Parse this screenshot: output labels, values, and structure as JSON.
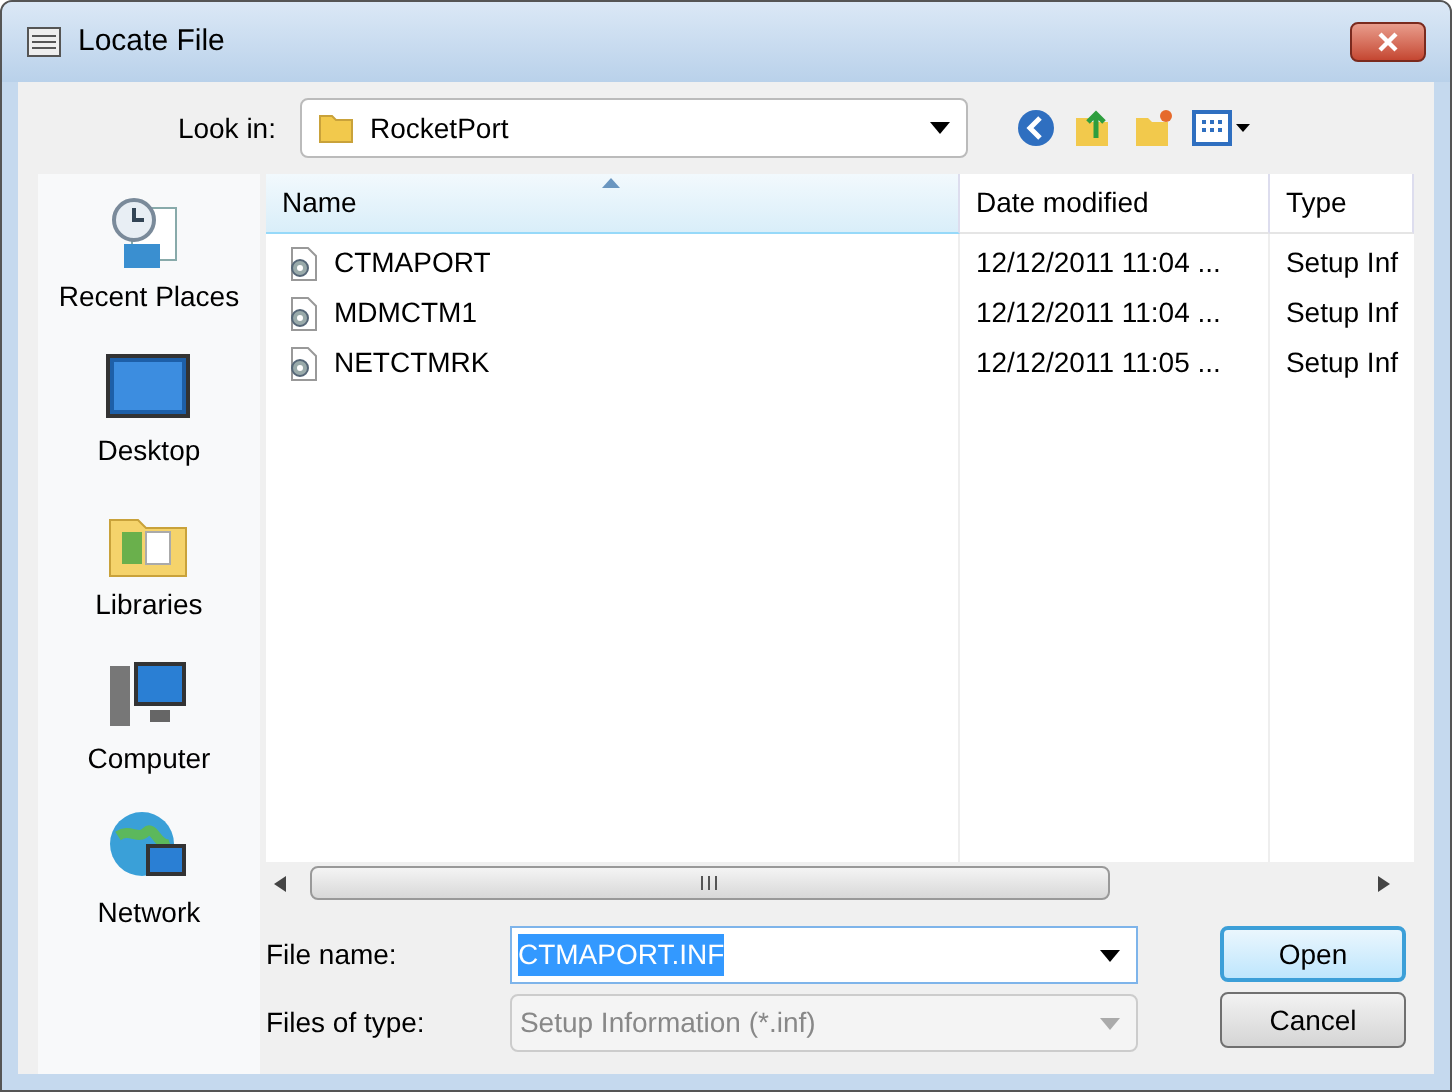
{
  "window": {
    "title": "Locate File"
  },
  "look_in": {
    "label": "Look in:",
    "value": "RocketPort"
  },
  "sidebar": {
    "items": [
      {
        "label": "Recent Places",
        "kind": "recent"
      },
      {
        "label": "Desktop",
        "kind": "desktop"
      },
      {
        "label": "Libraries",
        "kind": "libraries"
      },
      {
        "label": "Computer",
        "kind": "computer"
      },
      {
        "label": "Network",
        "kind": "network"
      }
    ]
  },
  "table": {
    "columns": [
      {
        "label": "Name",
        "sorted": true
      },
      {
        "label": "Date modified",
        "sorted": false
      },
      {
        "label": "Type",
        "sorted": false
      }
    ],
    "rows": [
      {
        "name": "CTMAPORT",
        "date": "12/12/2011 11:04 ...",
        "type": "Setup Inf"
      },
      {
        "name": "MDMCTM1",
        "date": "12/12/2011 11:04 ...",
        "type": "Setup Inf"
      },
      {
        "name": "NETCTMRK",
        "date": "12/12/2011 11:05 ...",
        "type": "Setup Inf"
      }
    ]
  },
  "file_name": {
    "label": "File name:",
    "value": "CTMAPORT.INF",
    "selected": true
  },
  "files_of_type": {
    "label": "Files of type:",
    "value": "Setup Information (*.inf)",
    "disabled": true
  },
  "buttons": [
    {
      "label": "Open",
      "default": true
    },
    {
      "label": "Cancel",
      "default": false
    }
  ]
}
